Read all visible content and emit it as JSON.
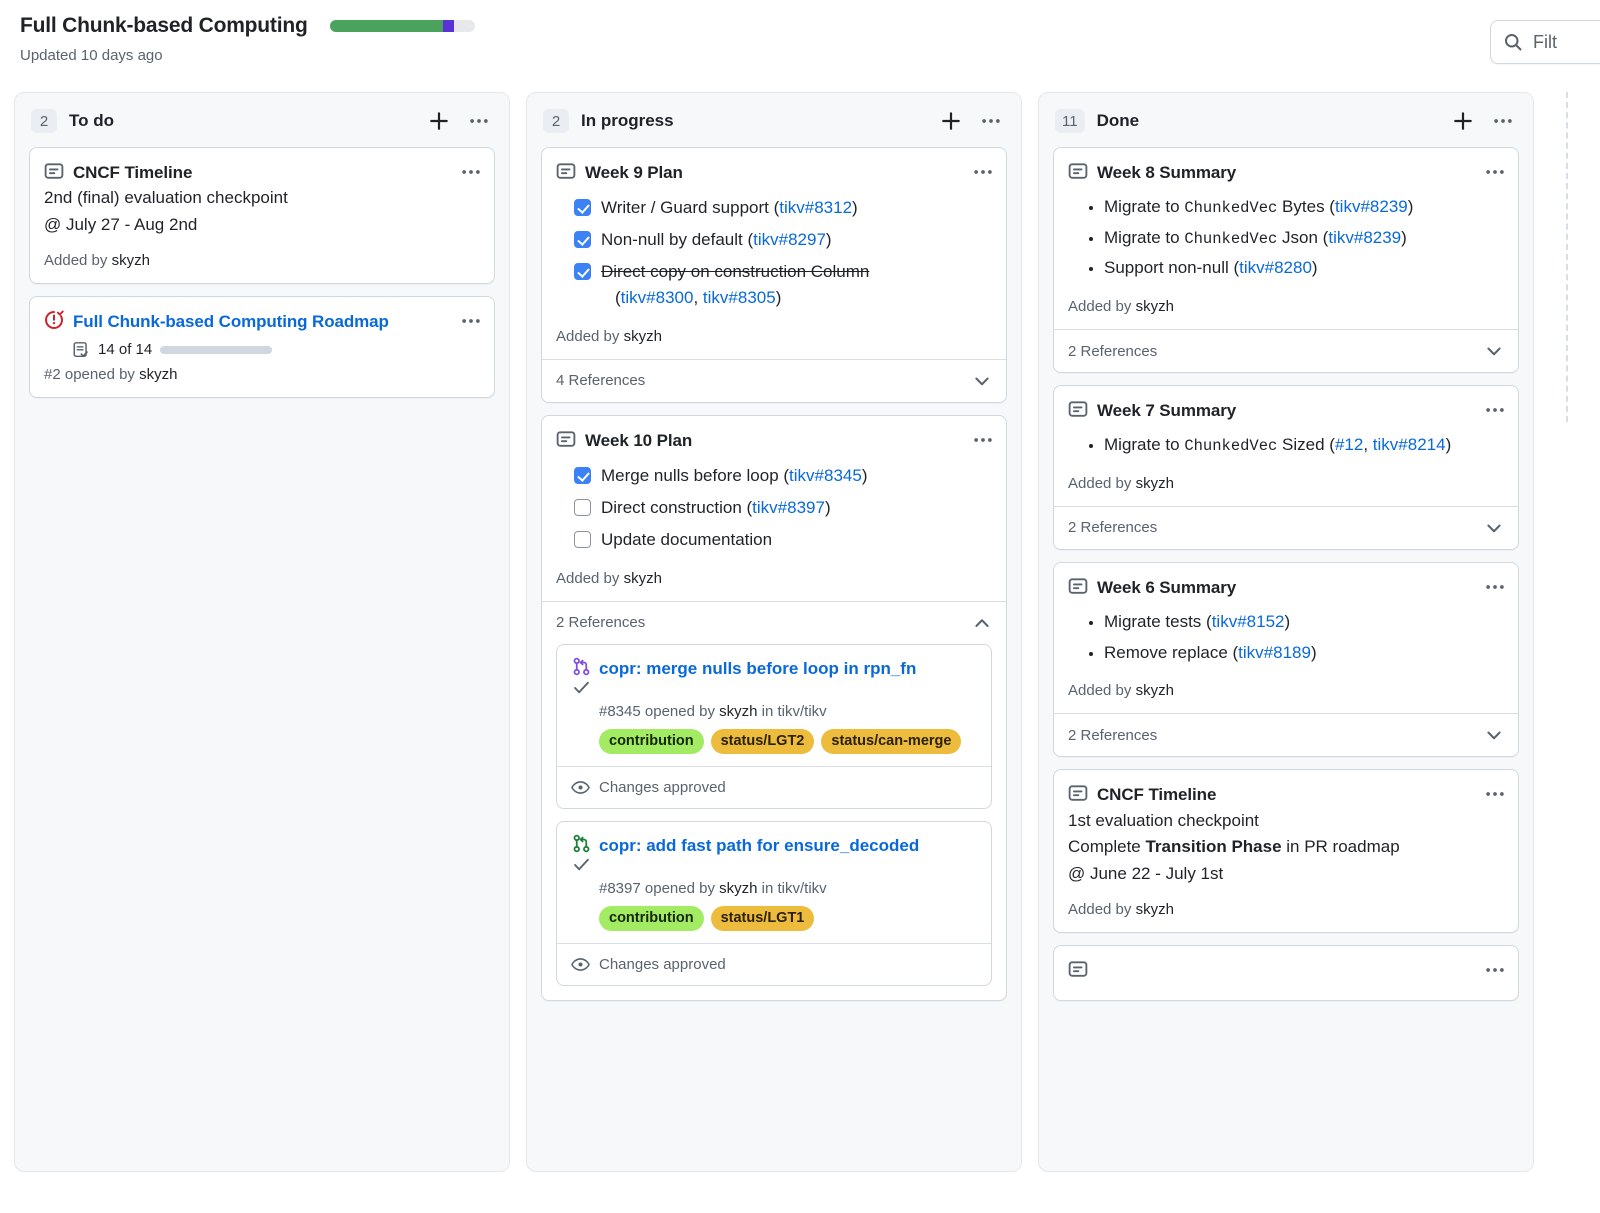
{
  "header": {
    "title": "Full Chunk-based Computing",
    "subtitle": "Updated 10 days ago",
    "progress": {
      "green_pct": 78,
      "purple_pct": 8,
      "gray_pct": 14,
      "green_color": "#4aa25c",
      "purple_color": "#5a32d6",
      "track_color": "#e6e8eb"
    },
    "filter": {
      "placeholder": "Filt",
      "icon": "search-icon"
    }
  },
  "columns": [
    {
      "name": "To do",
      "count": "2",
      "add_label": "+",
      "menu_label": "···",
      "cards": [
        {
          "type": "draft",
          "icon": "draft-issue-icon",
          "title": "CNCF Timeline",
          "body_lines": [
            [
              {
                "t": "2nd (final) evaluation checkpoint"
              }
            ],
            [
              {
                "t": "@ July 27 - Aug 2nd"
              }
            ]
          ],
          "added_by": "Added by ",
          "added_user": "skyzh"
        },
        {
          "type": "issue",
          "icon": "issue-open-icon",
          "title": "Full Chunk-based Computing Roadmap",
          "title_is_link": true,
          "tasklist": {
            "icon": "tasklist-icon",
            "count_label": "14 of 14",
            "fill_pct": 100
          },
          "meta_prefix": "#2 opened by ",
          "meta_user": "skyzh"
        }
      ]
    },
    {
      "name": "In progress",
      "count": "2",
      "add_label": "+",
      "menu_label": "···",
      "cards": [
        {
          "type": "draft",
          "icon": "draft-issue-icon",
          "title": "Week 9 Plan",
          "checklist": [
            {
              "checked": true,
              "struck": false,
              "parts": [
                {
                  "t": "Writer / Guard support ("
                },
                {
                  "t": "tikv#8312",
                  "link": true
                },
                {
                  "t": ")"
                }
              ]
            },
            {
              "checked": true,
              "struck": false,
              "parts": [
                {
                  "t": "Non-null by default ("
                },
                {
                  "t": "tikv#8297",
                  "link": true
                },
                {
                  "t": ")"
                }
              ]
            },
            {
              "checked": true,
              "struck": true,
              "parts": [
                {
                  "t": "Direct copy on construction Column",
                  "struck": true
                }
              ],
              "sub_parts": [
                {
                  "t": "("
                },
                {
                  "t": "tikv#8300",
                  "link": true
                },
                {
                  "t": ", "
                },
                {
                  "t": "tikv#8305",
                  "link": true
                },
                {
                  "t": ")"
                }
              ]
            }
          ],
          "added_by": "Added by ",
          "added_user": "skyzh",
          "references": {
            "label": "4 References",
            "expanded": false,
            "chevron": "chevron-down-icon",
            "items": []
          }
        },
        {
          "type": "draft",
          "icon": "draft-issue-icon",
          "title": "Week 10 Plan",
          "checklist": [
            {
              "checked": true,
              "struck": false,
              "parts": [
                {
                  "t": "Merge nulls before loop ("
                },
                {
                  "t": "tikv#8345",
                  "link": true
                },
                {
                  "t": ")"
                }
              ]
            },
            {
              "checked": false,
              "struck": false,
              "parts": [
                {
                  "t": "Direct construction ("
                },
                {
                  "t": "tikv#8397",
                  "link": true
                },
                {
                  "t": ")"
                }
              ]
            },
            {
              "checked": false,
              "struck": false,
              "parts": [
                {
                  "t": "Update documentation"
                }
              ]
            }
          ],
          "added_by": "Added by ",
          "added_user": "skyzh",
          "references": {
            "label": "2 References",
            "expanded": true,
            "chevron": "chevron-up-icon",
            "items": [
              {
                "icon": "pull-request-merged-icon",
                "icon_color": "#8250df",
                "status_icon": "check-icon",
                "title": "copr: merge nulls before loop in rpn_fn",
                "meta_prefix": "#8345 opened by ",
                "meta_user": "skyzh",
                "meta_suffix": " in tikv/tikv",
                "labels": [
                  {
                    "text": "contribution",
                    "bg": "#a2eb63",
                    "fg": "#14260b"
                  },
                  {
                    "text": "status/LGT2",
                    "bg": "#edbc3c",
                    "fg": "#2b2008"
                  },
                  {
                    "text": "status/can-merge",
                    "bg": "#edbc3c",
                    "fg": "#2b2008"
                  }
                ],
                "status": {
                  "icon": "eye-icon",
                  "text": "Changes approved"
                }
              },
              {
                "icon": "pull-request-open-icon",
                "icon_color": "#1a7f37",
                "status_icon": "check-icon",
                "title": "copr: add fast path for ensure_decoded",
                "meta_prefix": "#8397 opened by ",
                "meta_user": "skyzh",
                "meta_suffix": " in tikv/tikv",
                "labels": [
                  {
                    "text": "contribution",
                    "bg": "#a2eb63",
                    "fg": "#14260b"
                  },
                  {
                    "text": "status/LGT1",
                    "bg": "#edbc3c",
                    "fg": "#2b2008"
                  }
                ],
                "status": {
                  "icon": "eye-icon",
                  "text": "Changes approved"
                }
              }
            ]
          }
        }
      ]
    },
    {
      "name": "Done",
      "count": "11",
      "add_label": "+",
      "menu_label": "···",
      "cards": [
        {
          "type": "draft",
          "icon": "draft-issue-icon",
          "title": "Week 8 Summary",
          "bullets": [
            [
              {
                "t": "Migrate to "
              },
              {
                "t": "ChunkedVec",
                "code": true
              },
              {
                "t": " Bytes ("
              },
              {
                "t": "tikv#8239",
                "link": true
              },
              {
                "t": ")"
              }
            ],
            [
              {
                "t": "Migrate to "
              },
              {
                "t": "ChunkedVec",
                "code": true
              },
              {
                "t": " Json ("
              },
              {
                "t": "tikv#8239",
                "link": true
              },
              {
                "t": ")"
              }
            ],
            [
              {
                "t": "Support non-null ("
              },
              {
                "t": "tikv#8280",
                "link": true
              },
              {
                "t": ")"
              }
            ]
          ],
          "added_by": "Added by ",
          "added_user": "skyzh",
          "references": {
            "label": "2 References",
            "expanded": false,
            "chevron": "chevron-down-icon",
            "items": []
          }
        },
        {
          "type": "draft",
          "icon": "draft-issue-icon",
          "title": "Week 7 Summary",
          "bullets": [
            [
              {
                "t": "Migrate to "
              },
              {
                "t": "ChunkedVec",
                "code": true
              },
              {
                "t": " Sized ("
              },
              {
                "t": "#12",
                "link": true
              },
              {
                "t": ", "
              },
              {
                "t": "tikv#8214",
                "link": true
              },
              {
                "t": ")"
              }
            ]
          ],
          "added_by": "Added by ",
          "added_user": "skyzh",
          "references": {
            "label": "2 References",
            "expanded": false,
            "chevron": "chevron-down-icon",
            "items": []
          }
        },
        {
          "type": "draft",
          "icon": "draft-issue-icon",
          "title": "Week 6 Summary",
          "bullets": [
            [
              {
                "t": "Migrate tests ("
              },
              {
                "t": "tikv#8152",
                "link": true
              },
              {
                "t": ")"
              }
            ],
            [
              {
                "t": "Remove replace ("
              },
              {
                "t": "tikv#8189",
                "link": true
              },
              {
                "t": ")"
              }
            ]
          ],
          "added_by": "Added by ",
          "added_user": "skyzh",
          "references": {
            "label": "2 References",
            "expanded": false,
            "chevron": "chevron-down-icon",
            "items": []
          }
        },
        {
          "type": "draft",
          "icon": "draft-issue-icon",
          "title": "CNCF Timeline",
          "body_lines": [
            [
              {
                "t": "1st evaluation checkpoint"
              }
            ],
            [
              {
                "t": "Complete "
              },
              {
                "t": "Transition Phase",
                "bold": true
              },
              {
                "t": " in PR roadmap"
              }
            ],
            [
              {
                "t": "@ June 22 - July 1st"
              }
            ]
          ],
          "added_by": "Added by ",
          "added_user": "skyzh"
        },
        {
          "type": "clipped",
          "icon": "draft-issue-icon",
          "title": ""
        }
      ]
    }
  ]
}
